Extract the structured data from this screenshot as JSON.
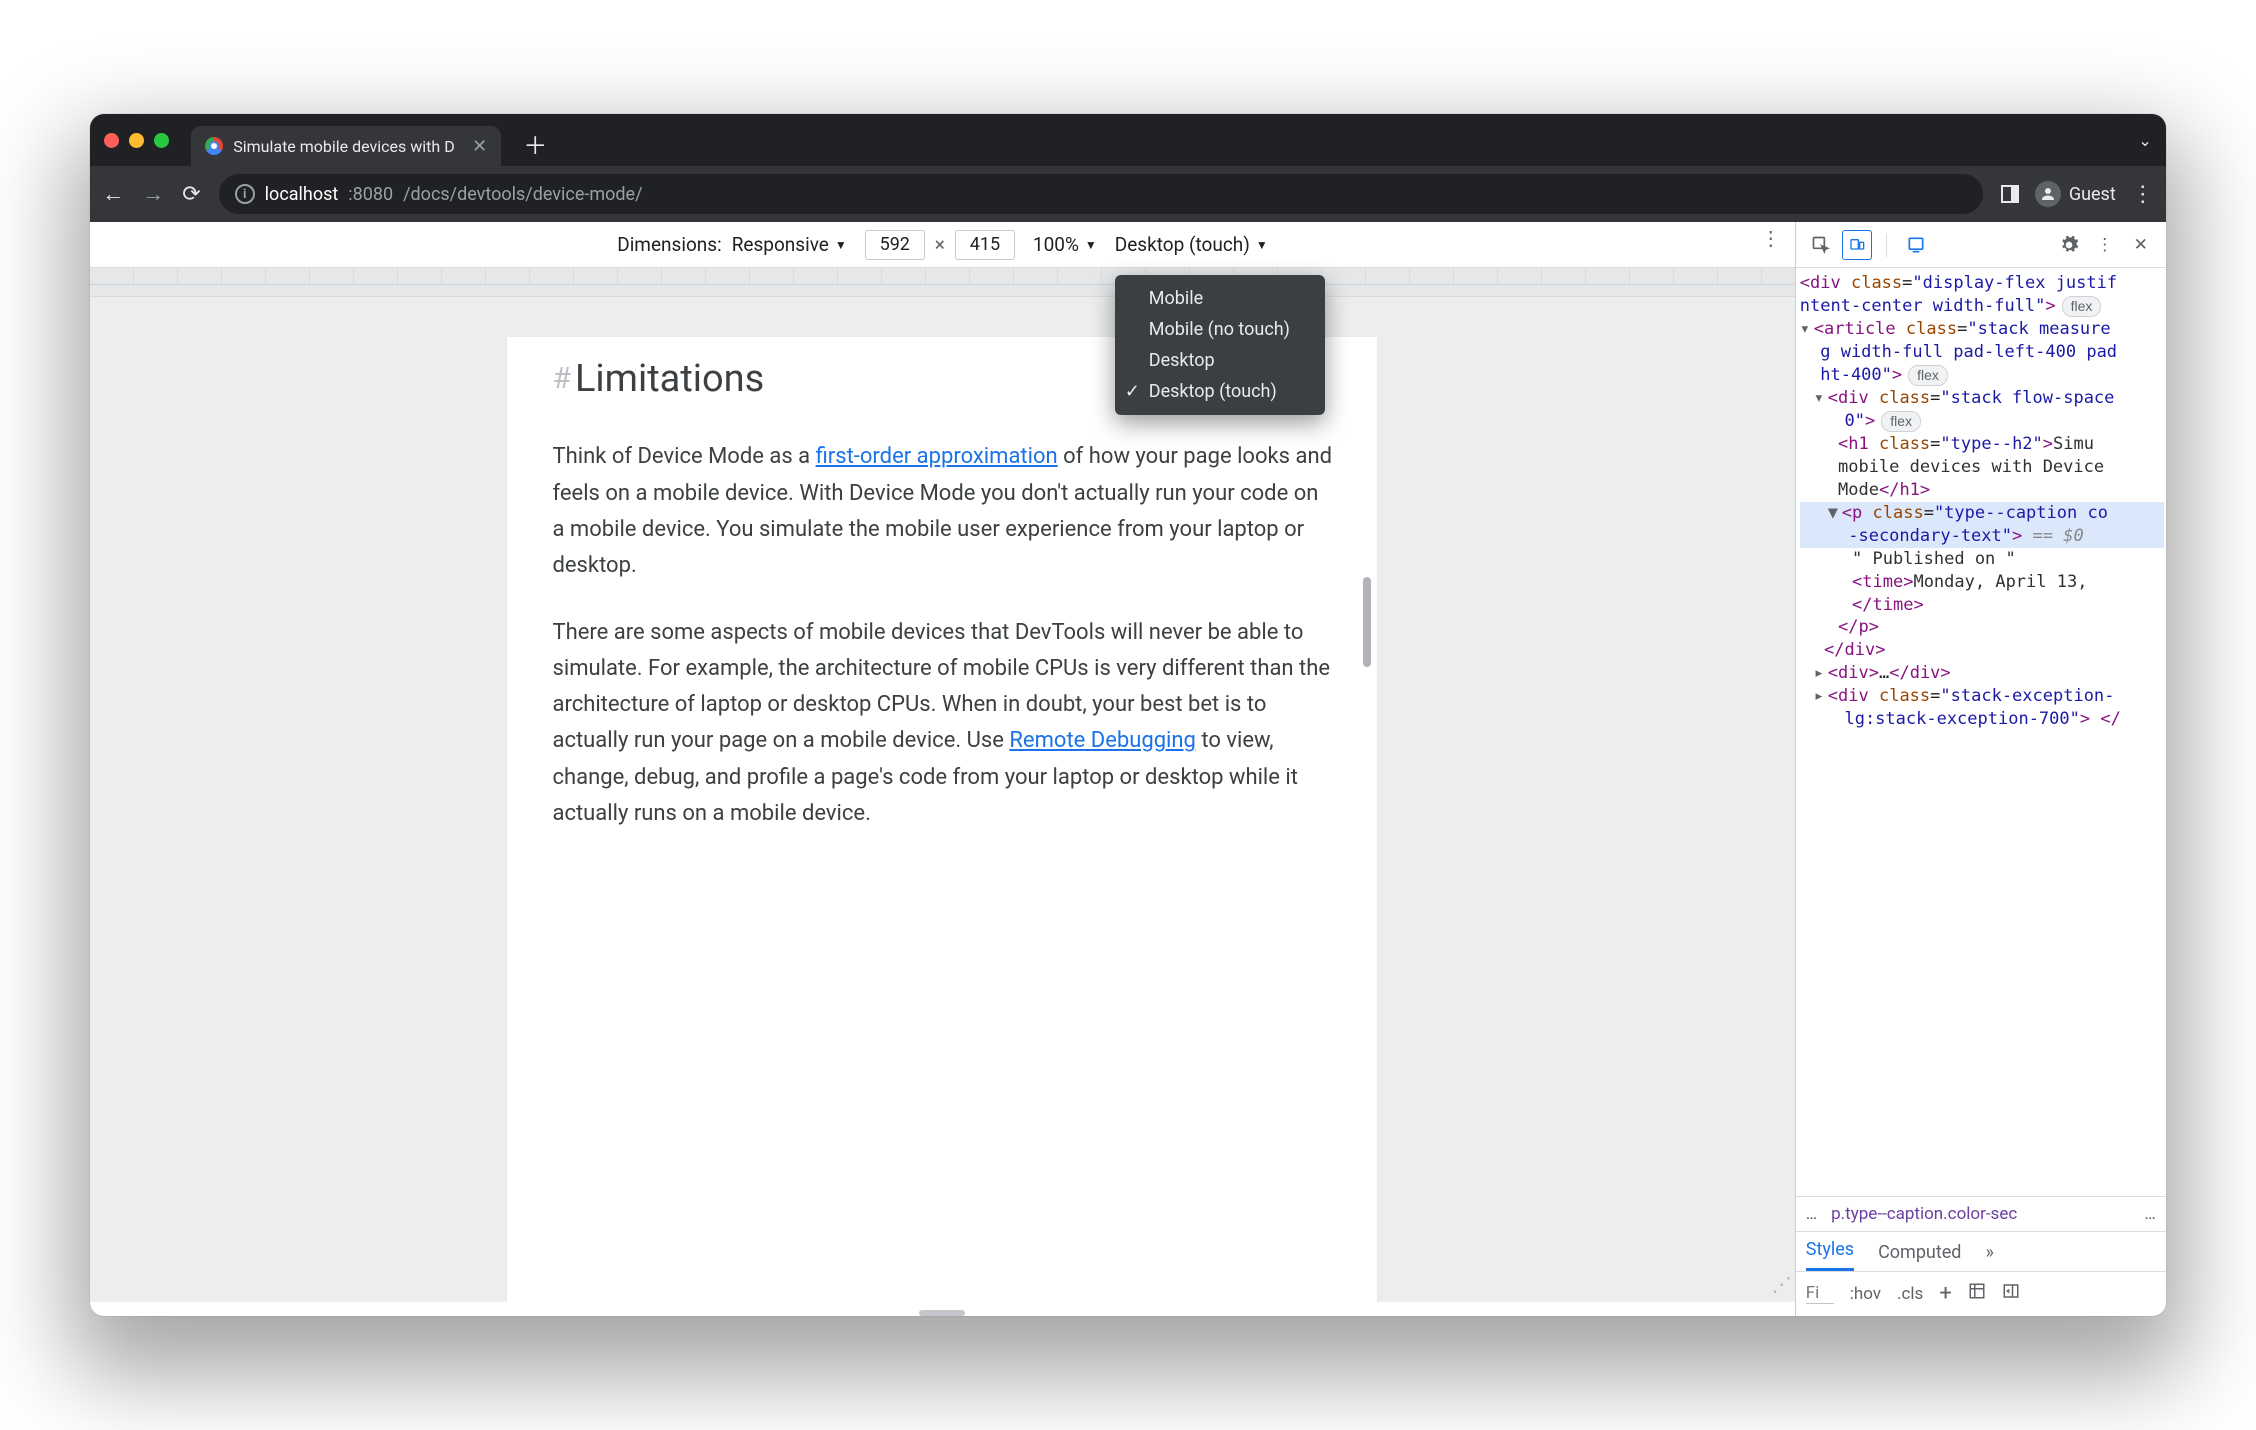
{
  "browser": {
    "tab_title": "Simulate mobile devices with D",
    "url_host": "localhost",
    "url_port": ":8080",
    "url_path": "/docs/devtools/device-mode/",
    "guest_label": "Guest"
  },
  "device_toolbar": {
    "dimensions_label": "Dimensions:",
    "dimensions_mode": "Responsive",
    "width": "592",
    "height": "415",
    "separator": "×",
    "zoom": "100%",
    "device_type_selected": "Desktop (touch)",
    "device_type_options": [
      {
        "label": "Mobile",
        "checked": false
      },
      {
        "label": "Mobile (no touch)",
        "checked": false
      },
      {
        "label": "Desktop",
        "checked": false
      },
      {
        "label": "Desktop (touch)",
        "checked": true
      }
    ]
  },
  "page": {
    "heading": "Limitations",
    "p1_a": "Think of Device Mode as a ",
    "p1_link": "first-order approximation",
    "p1_b": " of how your page looks and feels on a mobile device. With Device Mode you don't actually run your code on a mobile device. You simulate the mobile user experience from your laptop or desktop.",
    "p2_a": "There are some aspects of mobile devices that DevTools will never be able to simulate. For example, the architecture of mobile CPUs is very different than the architecture of laptop or desktop CPUs. When in doubt, your best bet is to actually run your page on a mobile device. Use ",
    "p2_link": "Remote Debugging",
    "p2_b": " to view, change, debug, and profile a page's code from your laptop or desktop while it actually runs on a mobile device."
  },
  "devtools": {
    "dom_lines": [
      {
        "indent": 0,
        "html": "<span class='punct'>&lt;</span><span class='tag'>div</span> <span class='attr'>class</span>=<span class='val'>\"display-flex justif</span>"
      },
      {
        "indent": 0,
        "html": "<span class='val'>ntent-center width-full\"</span><span class='punct'>&gt;</span><span class='flexbadge'>flex</span>"
      },
      {
        "indent": 0,
        "html": "<span class='twisty'>▾</span><span class='punct'>&lt;</span><span class='tag'>article</span> <span class='attr'>class</span>=<span class='val'>\"stack measure</span>"
      },
      {
        "indent": 0,
        "html": "  <span class='val'>g width-full pad-left-400 pad</span>"
      },
      {
        "indent": 0,
        "html": "  <span class='val'>ht-400\"</span><span class='punct'>&gt;</span><span class='flexbadge'>flex</span>"
      },
      {
        "indent": 1,
        "html": "<span class='twisty'>▾</span><span class='punct'>&lt;</span><span class='tag'>div</span> <span class='attr'>class</span>=<span class='val'>\"stack flow-space</span>"
      },
      {
        "indent": 1,
        "html": "   <span class='val'>0\"</span><span class='punct'>&gt;</span><span class='flexbadge'>flex</span>"
      },
      {
        "indent": 2,
        "html": " <span class='punct'>&lt;</span><span class='tag'>h1</span> <span class='attr'>class</span>=<span class='val'>\"type--h2\"</span><span class='punct'>&gt;</span><span class='txtnode'>Simu</span>"
      },
      {
        "indent": 2,
        "html": " <span class='txtnode'>mobile devices with Device</span>"
      },
      {
        "indent": 2,
        "html": " <span class='txtnode'>Mode</span><span class='punct'>&lt;/</span><span class='tag'>h1</span><span class='punct'>&gt;</span>"
      },
      {
        "indent": 2,
        "sel": true,
        "html": "<span class='twisty'>▼</span><span class='punct'>&lt;</span><span class='tag'>p</span> <span class='attr'>class</span>=<span class='val'>\"type--caption co</span>"
      },
      {
        "indent": 2,
        "sel": true,
        "html": "  <span class='val'>-secondary-text\"</span><span class='punct'>&gt;</span> <span class='eqzero'>== $0</span>"
      },
      {
        "indent": 3,
        "html": " <span class='txtnode'>\" Published on \"</span>"
      },
      {
        "indent": 3,
        "html": " <span class='punct'>&lt;</span><span class='tag'>time</span><span class='punct'>&gt;</span><span class='txtnode'>Monday, April 13,</span>"
      },
      {
        "indent": 3,
        "html": " <span class='punct'>&lt;/</span><span class='tag'>time</span><span class='punct'>&gt;</span>"
      },
      {
        "indent": 2,
        "html": " <span class='punct'>&lt;/</span><span class='tag'>p</span><span class='punct'>&gt;</span>"
      },
      {
        "indent": 1,
        "html": " <span class='punct'>&lt;/</span><span class='tag'>div</span><span class='punct'>&gt;</span>"
      },
      {
        "indent": 1,
        "html": "<span class='twisty'>▸</span><span class='punct'>&lt;</span><span class='tag'>div</span><span class='punct'>&gt;</span>…<span class='punct'>&lt;/</span><span class='tag'>div</span><span class='punct'>&gt;</span>"
      },
      {
        "indent": 1,
        "html": "<span class='twisty'>▸</span><span class='punct'>&lt;</span><span class='tag'>div</span> <span class='attr'>class</span>=<span class='val'>\"stack-exception-</span>"
      },
      {
        "indent": 1,
        "html": "   <span class='val'>lg:stack-exception-700\"</span><span class='punct'>&gt;</span> <span class='punct'>&lt;/</span>"
      }
    ],
    "breadcrumb_more": "…",
    "breadcrumb_sel": "p.type--caption.color-sec",
    "tabs": {
      "styles": "Styles",
      "computed": "Computed"
    },
    "filter_placeholder": "Fi",
    "hov": ":hov",
    "cls": ".cls"
  }
}
